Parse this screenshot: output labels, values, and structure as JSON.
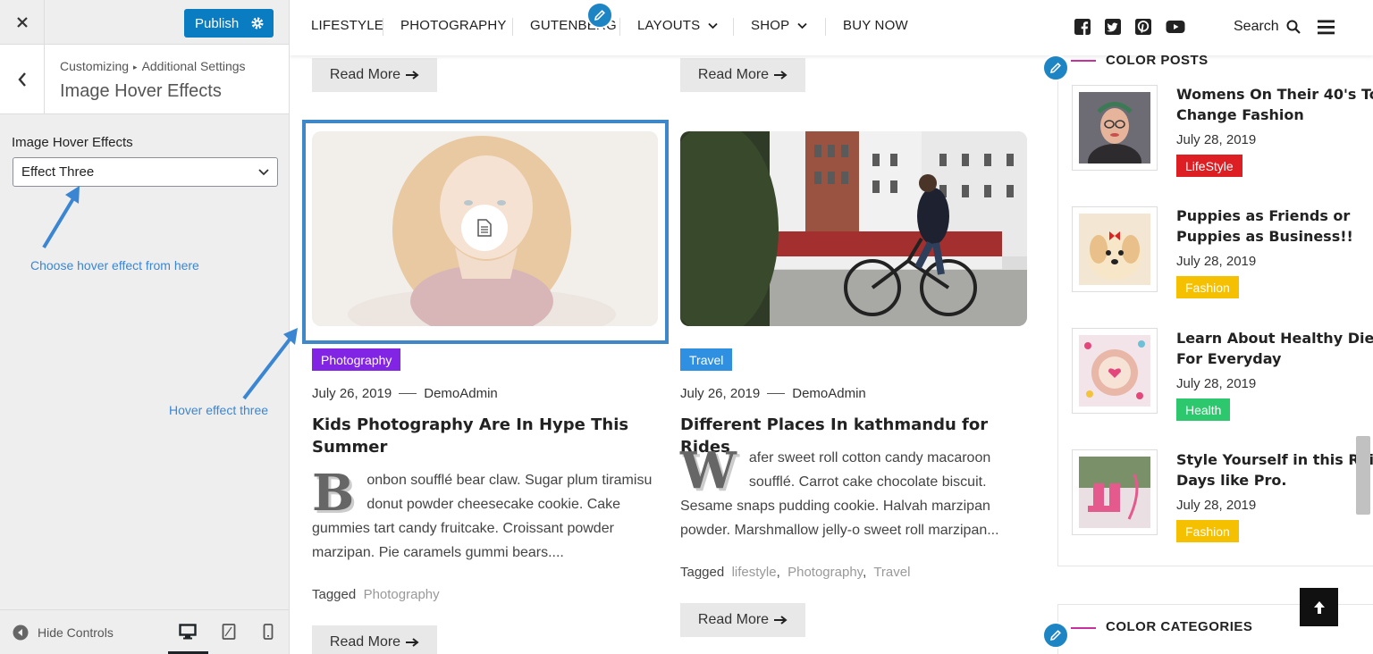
{
  "customizer": {
    "publish_label": "Publish",
    "breadcrumb_root": "Customizing",
    "breadcrumb_sep": "▸",
    "breadcrumb_parent": "Additional Settings",
    "section_title": "Image Hover Effects",
    "control_label": "Image Hover Effects",
    "select_value": "Effect Three",
    "annotation_select": "Choose hover effect from here",
    "annotation_hover": "Hover effect three",
    "hide_controls": "Hide Controls"
  },
  "nav": {
    "items": [
      {
        "label": "LIFESTYLE",
        "dropdown": false
      },
      {
        "label": "PHOTOGRAPHY",
        "dropdown": false
      },
      {
        "label": "GUTENBERG",
        "dropdown": false
      },
      {
        "label": "LAYOUTS",
        "dropdown": true
      },
      {
        "label": "SHOP",
        "dropdown": true
      },
      {
        "label": "BUY NOW",
        "dropdown": false
      }
    ],
    "social_icons": [
      "facebook-icon",
      "twitter-icon",
      "pinterest-icon",
      "youtube-icon"
    ],
    "search_label": "Search"
  },
  "posts": {
    "read_more": "Read More",
    "left": {
      "category": "Photography",
      "category_color": "#8224e3",
      "date": "July 26, 2019",
      "author": "DemoAdmin",
      "title": "Kids Photography Are In Hype This Summer",
      "drop_cap": "B",
      "excerpt": "onbon soufflé bear claw. Sugar plum tiramisu donut powder cheesecake cookie. Cake gummies tart candy fruitcake. Croissant powder marzipan. Pie caramels gummi bears....",
      "tagged_label": "Tagged",
      "tags": "Photography"
    },
    "right": {
      "category": "Travel",
      "category_color": "#2f8fe0",
      "date": "July 26, 2019",
      "author": "DemoAdmin",
      "title": "Different Places In kathmandu for Rides",
      "drop_cap": "W",
      "excerpt": "afer sweet roll cotton candy macaroon soufflé. Carrot cake chocolate biscuit. Sesame snaps pudding cookie. Halvah marzipan powder. Marshmallow jelly-o sweet roll marzipan...",
      "tagged_label": "Tagged",
      "tag1": "lifestyle",
      "tag2": "Photography",
      "tag3": "Travel",
      "tag_sep": ","
    }
  },
  "sidebar": {
    "color_posts_title": "COLOR POSTS",
    "color_categories_title": "COLOR CATEGORIES",
    "posts": [
      {
        "title_line1": "Womens On Their 40's To",
        "title_line2": "Change Fashion",
        "date": "July 28, 2019",
        "category": "LifeStyle",
        "color": "#dd1f24"
      },
      {
        "title_line1": "Puppies as Friends or",
        "title_line2": "Puppies as Business!!",
        "date": "July 28, 2019",
        "category": "Fashion",
        "color": "#f5c000"
      },
      {
        "title_line1": "Learn About Healthy Diet",
        "title_line2": "For Everyday",
        "date": "July 28, 2019",
        "category": "Health",
        "color": "#2dc76d"
      },
      {
        "title_line1": "Style Yourself in this Rainy",
        "title_line2": "Days like Pro.",
        "date": "July 28, 2019",
        "category": "Fashion",
        "color": "#f5c000"
      }
    ]
  }
}
